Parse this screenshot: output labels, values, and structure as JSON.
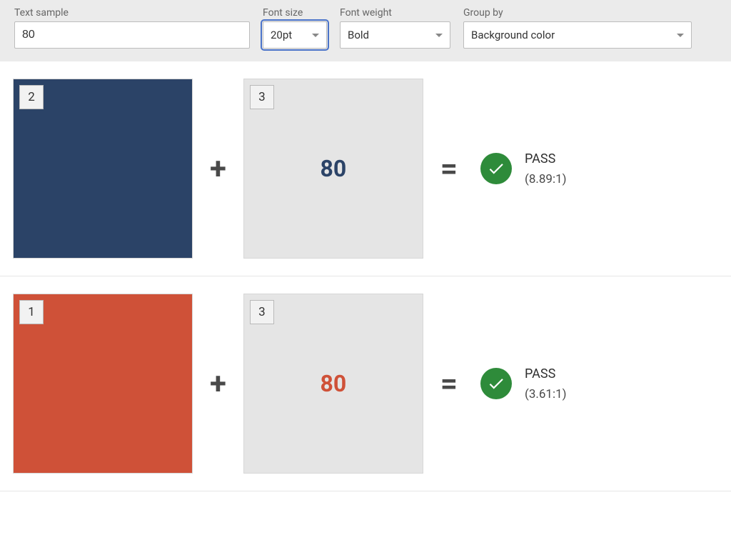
{
  "toolbar": {
    "text_sample": {
      "label": "Text sample",
      "value": "80"
    },
    "font_size": {
      "label": "Font size",
      "value": "20pt"
    },
    "font_weight": {
      "label": "Font weight",
      "value": "Bold"
    },
    "group_by": {
      "label": "Group by",
      "value": "Background color"
    }
  },
  "rows": [
    {
      "bg": {
        "badge": "2",
        "color": "#2b4367"
      },
      "fg": {
        "badge": "3",
        "color": "#e5e5e5",
        "text_color": "#2b4367",
        "sample": "80"
      },
      "result": {
        "label": "PASS",
        "ratio": "(8.89:1)"
      }
    },
    {
      "bg": {
        "badge": "1",
        "color": "#cf5138"
      },
      "fg": {
        "badge": "3",
        "color": "#e5e5e5",
        "text_color": "#cf5138",
        "sample": "80"
      },
      "result": {
        "label": "PASS",
        "ratio": "(3.61:1)"
      }
    }
  ]
}
